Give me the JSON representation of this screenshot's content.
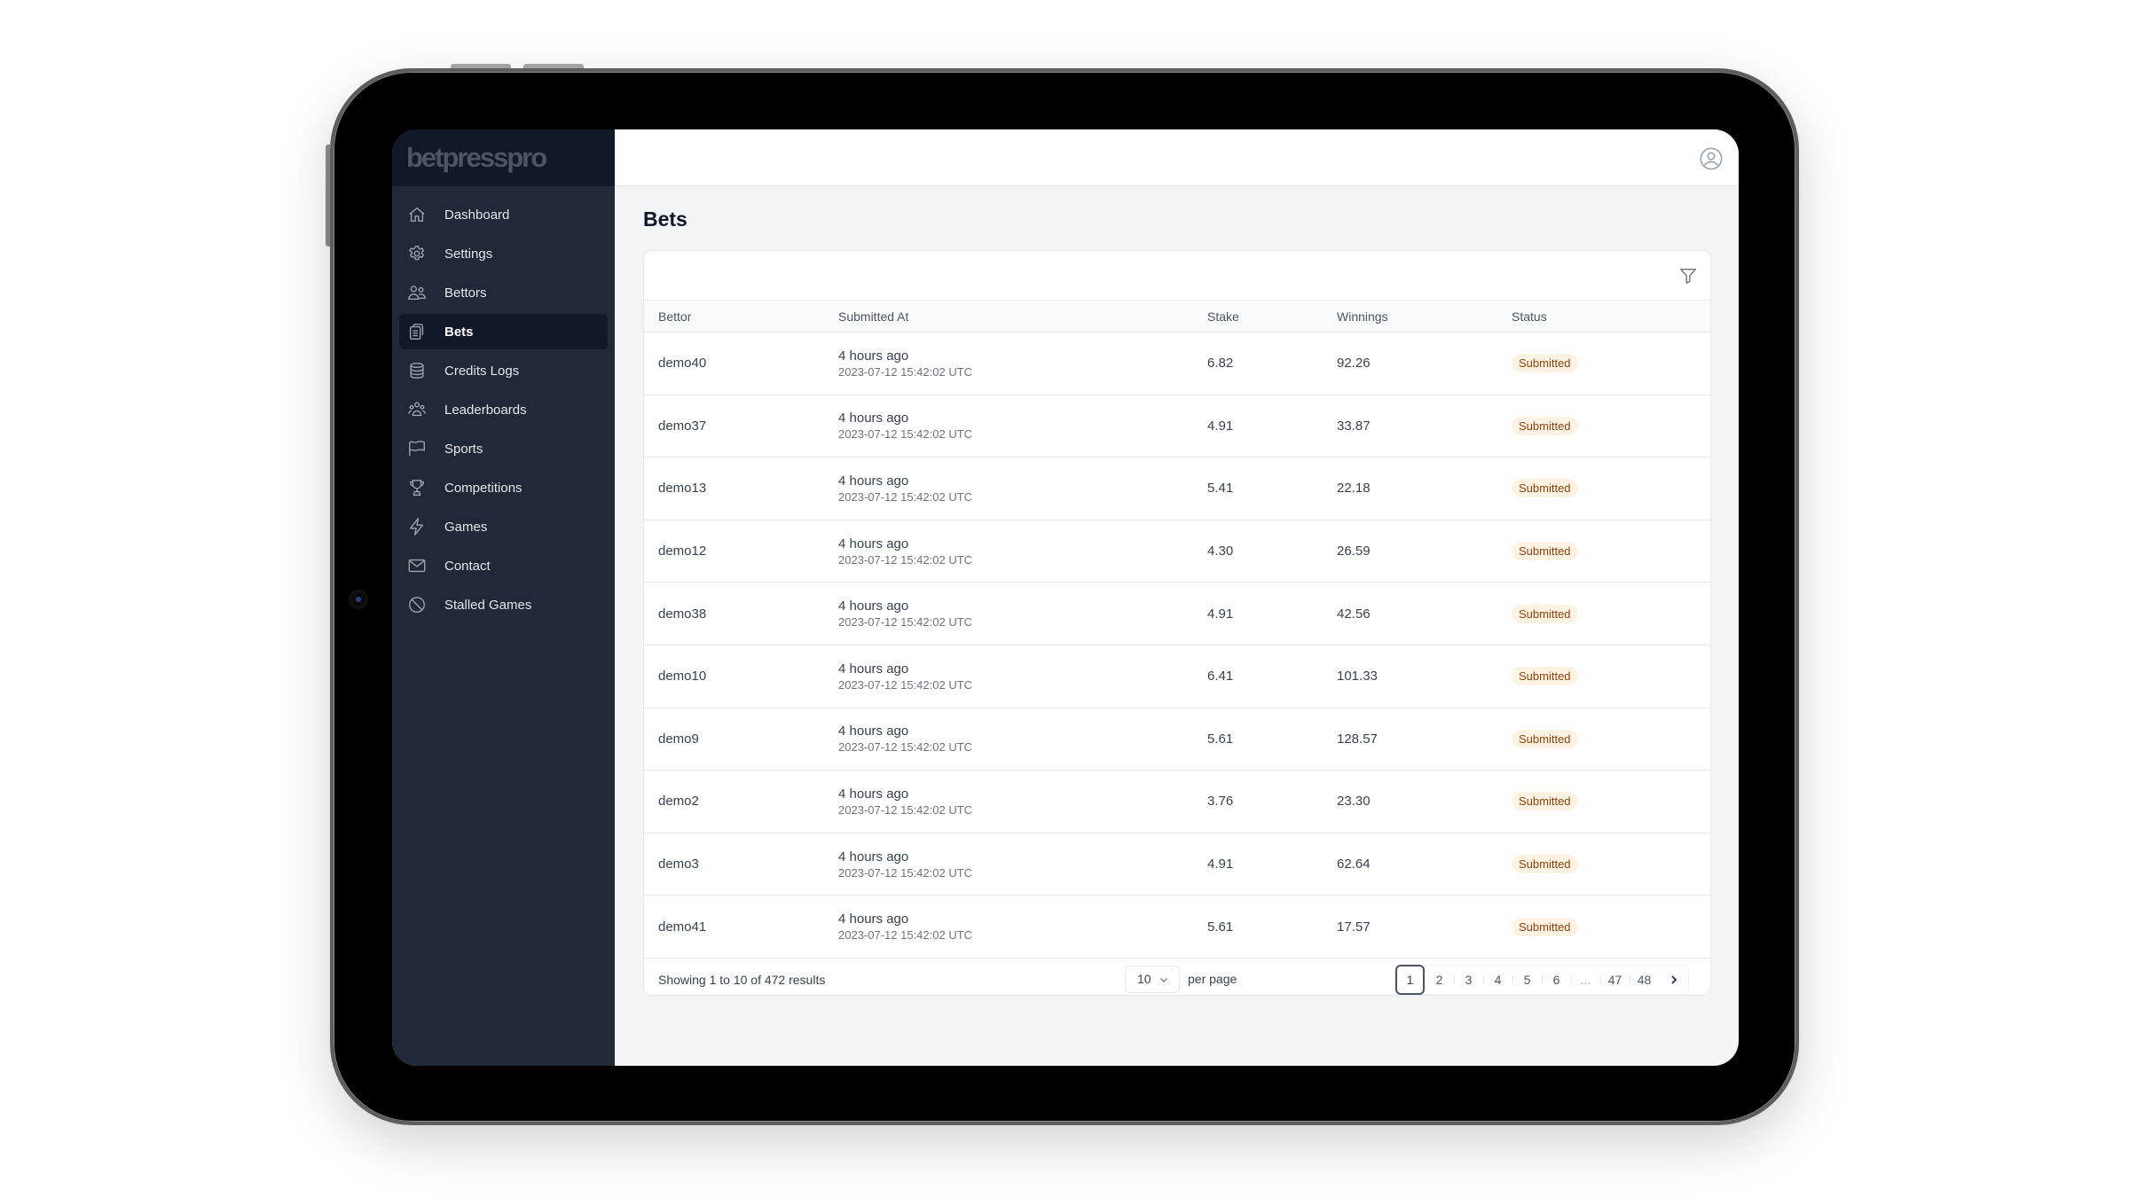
{
  "app": {
    "logo": "betpresspro"
  },
  "sidebar": {
    "items": [
      {
        "label": "Dashboard",
        "icon": "home-icon",
        "active": false
      },
      {
        "label": "Settings",
        "icon": "gear-icon",
        "active": false
      },
      {
        "label": "Bettors",
        "icon": "users-icon",
        "active": false
      },
      {
        "label": "Bets",
        "icon": "clipboard-list-icon",
        "active": true
      },
      {
        "label": "Credits Logs",
        "icon": "database-icon",
        "active": false
      },
      {
        "label": "Leaderboards",
        "icon": "user-group-icon",
        "active": false
      },
      {
        "label": "Sports",
        "icon": "flag-icon",
        "active": false
      },
      {
        "label": "Competitions",
        "icon": "trophy-icon",
        "active": false
      },
      {
        "label": "Games",
        "icon": "bolt-icon",
        "active": false
      },
      {
        "label": "Contact",
        "icon": "envelope-icon",
        "active": false
      },
      {
        "label": "Stalled Games",
        "icon": "no-symbol-icon",
        "active": false
      }
    ]
  },
  "header": {
    "user_icon": "user-circle-icon"
  },
  "page": {
    "title": "Bets"
  },
  "table": {
    "filter_icon": "funnel-icon",
    "columns": [
      "Bettor",
      "Submitted At",
      "Stake",
      "Winnings",
      "Status"
    ],
    "rows": [
      {
        "bettor": "demo40",
        "relative": "4 hours ago",
        "timestamp": "2023-07-12 15:42:02 UTC",
        "stake": "6.82",
        "winnings": "92.26",
        "status": "Submitted"
      },
      {
        "bettor": "demo37",
        "relative": "4 hours ago",
        "timestamp": "2023-07-12 15:42:02 UTC",
        "stake": "4.91",
        "winnings": "33.87",
        "status": "Submitted"
      },
      {
        "bettor": "demo13",
        "relative": "4 hours ago",
        "timestamp": "2023-07-12 15:42:02 UTC",
        "stake": "5.41",
        "winnings": "22.18",
        "status": "Submitted"
      },
      {
        "bettor": "demo12",
        "relative": "4 hours ago",
        "timestamp": "2023-07-12 15:42:02 UTC",
        "stake": "4.30",
        "winnings": "26.59",
        "status": "Submitted"
      },
      {
        "bettor": "demo38",
        "relative": "4 hours ago",
        "timestamp": "2023-07-12 15:42:02 UTC",
        "stake": "4.91",
        "winnings": "42.56",
        "status": "Submitted"
      },
      {
        "bettor": "demo10",
        "relative": "4 hours ago",
        "timestamp": "2023-07-12 15:42:02 UTC",
        "stake": "6.41",
        "winnings": "101.33",
        "status": "Submitted"
      },
      {
        "bettor": "demo9",
        "relative": "4 hours ago",
        "timestamp": "2023-07-12 15:42:02 UTC",
        "stake": "5.61",
        "winnings": "128.57",
        "status": "Submitted"
      },
      {
        "bettor": "demo2",
        "relative": "4 hours ago",
        "timestamp": "2023-07-12 15:42:02 UTC",
        "stake": "3.76",
        "winnings": "23.30",
        "status": "Submitted"
      },
      {
        "bettor": "demo3",
        "relative": "4 hours ago",
        "timestamp": "2023-07-12 15:42:02 UTC",
        "stake": "4.91",
        "winnings": "62.64",
        "status": "Submitted"
      },
      {
        "bettor": "demo41",
        "relative": "4 hours ago",
        "timestamp": "2023-07-12 15:42:02 UTC",
        "stake": "5.61",
        "winnings": "17.57",
        "status": "Submitted"
      }
    ]
  },
  "footer": {
    "showing": "Showing 1 to 10 of 472 results",
    "per_page_value": "10",
    "per_page_label": "per page",
    "pages": [
      "1",
      "2",
      "3",
      "4",
      "5",
      "6",
      "...",
      "47",
      "48"
    ],
    "current_page": "1"
  },
  "colors": {
    "sidebar_bg": "#1f2937",
    "sidebar_dark": "#111827",
    "badge_bg": "#fef3e2",
    "badge_text": "#92400e",
    "page_bg": "#f3f4f6"
  }
}
